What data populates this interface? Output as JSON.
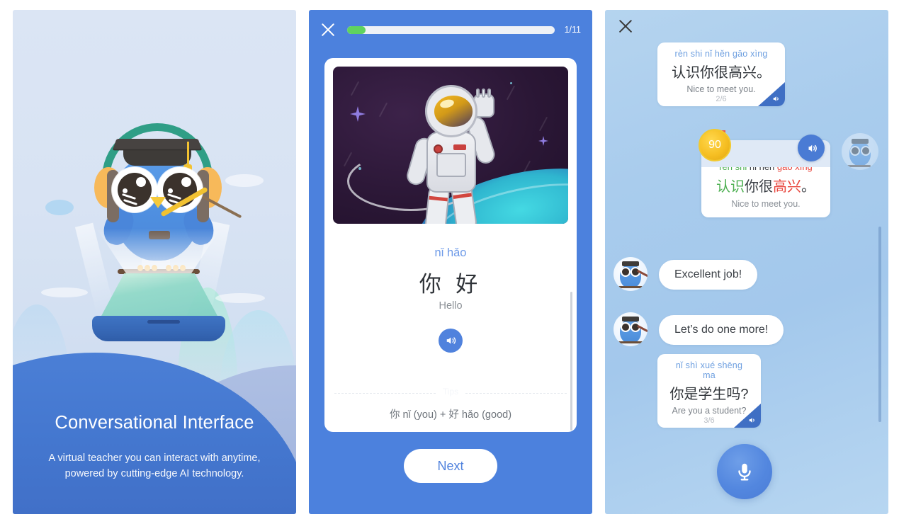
{
  "onboarding": {
    "title": "Conversational Interface",
    "subtitle_line1": "A virtual teacher you can interact with anytime,",
    "subtitle_line2": "powered by cutting-edge AI technology.",
    "owl_icon": "owl-teacher-icon",
    "tablet_icon": "tablet-hologram-icon",
    "background_color": "#d6e2f2",
    "wave_color": "#4a7ad2"
  },
  "lesson": {
    "close_icon": "close-icon",
    "progress": {
      "current": 1,
      "total": 11,
      "label": "1/11",
      "percent": 9,
      "fill_color": "#5fd35f"
    },
    "card": {
      "image_icon": "astronaut-illustration",
      "pinyin": "nǐ hǎo",
      "hanzi": "你 好",
      "translation": "Hello",
      "audio_icon": "speaker-icon",
      "tips_label": "Tips",
      "tip_text": "你 nǐ (you) + 好 hǎo (good)"
    },
    "next_label": "Next",
    "accent_color": "#4c81dd"
  },
  "chat": {
    "close_icon": "close-icon",
    "bubble_prompt": {
      "pinyin": "rèn shi nǐ hěn gāo xìng",
      "hanzi": "认识你很高兴。",
      "translation": "Nice to meet you.",
      "count": "2/6",
      "speaker_icon": "speaker-icon"
    },
    "bubble_scored": {
      "score": "90",
      "medal_icon": "gold-medal-icon",
      "speaker_icon": "speaker-waves-icon",
      "pinyin_tokens": [
        {
          "text": "rèn shi",
          "status": "ok"
        },
        {
          "text": " nǐ hěn ",
          "status": "mid"
        },
        {
          "text": "gāo xìng",
          "status": "bad"
        }
      ],
      "hanzi_tokens": [
        {
          "text": "认识",
          "status": "ok"
        },
        {
          "text": "你很",
          "status": "mid"
        },
        {
          "text": "高兴",
          "status": "bad"
        },
        {
          "text": "。",
          "status": "mid"
        }
      ],
      "translation": "Nice to meet you.",
      "ok_color": "#4caf50",
      "bad_color": "#e8453c"
    },
    "messages": [
      {
        "avatar": "owl-avatar-icon",
        "text": "Excellent job!"
      },
      {
        "avatar": "owl-avatar-icon",
        "text": "Let’s do one more!"
      }
    ],
    "bubble_question": {
      "pinyin": "nǐ shì xué shēng ma",
      "hanzi": "你是学生吗?",
      "translation": "Are you a student?",
      "count": "3/6",
      "speaker_icon": "speaker-icon"
    },
    "mic_icon": "microphone-icon",
    "background_color": "#a9cced"
  }
}
